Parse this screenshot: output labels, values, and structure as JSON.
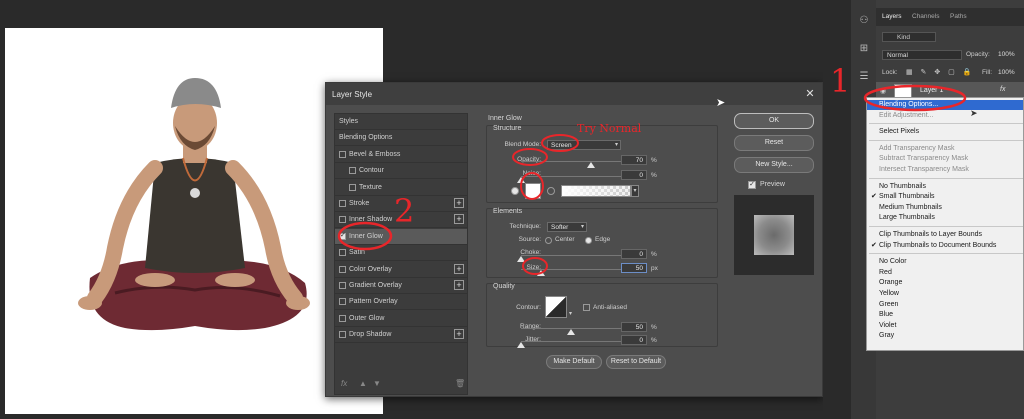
{
  "dialog": {
    "title": "Layer Style",
    "close_glyph": "✕",
    "styles_list": [
      {
        "label": "Styles",
        "checkbox": false,
        "checked": false,
        "sub": false,
        "plus": false,
        "selected": false
      },
      {
        "label": "Blending Options",
        "checkbox": false,
        "checked": false,
        "sub": false,
        "plus": false,
        "selected": false
      },
      {
        "label": "Bevel & Emboss",
        "checkbox": true,
        "checked": false,
        "sub": false,
        "plus": false,
        "selected": false
      },
      {
        "label": "Contour",
        "checkbox": true,
        "checked": false,
        "sub": true,
        "plus": false,
        "selected": false
      },
      {
        "label": "Texture",
        "checkbox": true,
        "checked": false,
        "sub": true,
        "plus": false,
        "selected": false
      },
      {
        "label": "Stroke",
        "checkbox": true,
        "checked": false,
        "sub": false,
        "plus": true,
        "selected": false
      },
      {
        "label": "Inner Shadow",
        "checkbox": true,
        "checked": false,
        "sub": false,
        "plus": true,
        "selected": false
      },
      {
        "label": "Inner Glow",
        "checkbox": true,
        "checked": true,
        "sub": false,
        "plus": false,
        "selected": true
      },
      {
        "label": "Satin",
        "checkbox": true,
        "checked": false,
        "sub": false,
        "plus": false,
        "selected": false
      },
      {
        "label": "Color Overlay",
        "checkbox": true,
        "checked": false,
        "sub": false,
        "plus": true,
        "selected": false
      },
      {
        "label": "Gradient Overlay",
        "checkbox": true,
        "checked": false,
        "sub": false,
        "plus": true,
        "selected": false
      },
      {
        "label": "Pattern Overlay",
        "checkbox": true,
        "checked": false,
        "sub": false,
        "plus": false,
        "selected": false
      },
      {
        "label": "Outer Glow",
        "checkbox": true,
        "checked": false,
        "sub": false,
        "plus": false,
        "selected": false
      },
      {
        "label": "Drop Shadow",
        "checkbox": true,
        "checked": false,
        "sub": false,
        "plus": true,
        "selected": false
      }
    ],
    "list_footer": {
      "fx": "fx",
      "up": "▲",
      "down": "▼",
      "trash": "🗑"
    },
    "section_title": "Inner Glow",
    "structure": {
      "title": "Structure",
      "blend_mode_label": "Blend Mode:",
      "blend_mode_value": "Screen",
      "opacity_label": "Opacity:",
      "opacity_value": "70",
      "opacity_fraction": 0.7,
      "noise_label": "Noise:",
      "noise_value": "0",
      "noise_fraction": 0,
      "unit": "%"
    },
    "elements": {
      "title": "Elements",
      "technique_label": "Technique:",
      "technique_value": "Softer",
      "source_label": "Source:",
      "source_center": "Center",
      "source_edge": "Edge",
      "choke_label": "Choke:",
      "choke_value": "0",
      "choke_fraction": 0,
      "size_label": "Size:",
      "size_value": "50",
      "size_fraction": 0.2,
      "size_unit": "px",
      "unit": "%"
    },
    "quality": {
      "title": "Quality",
      "contour_label": "Contour:",
      "anti_aliased_label": "Anti-aliased",
      "range_label": "Range:",
      "range_value": "50",
      "range_fraction": 0.5,
      "jitter_label": "Jitter:",
      "jitter_value": "0",
      "jitter_fraction": 0,
      "unit": "%"
    },
    "make_default": "Make Default",
    "reset_to_default": "Reset to Default",
    "ok": "OK",
    "reset": "Reset",
    "new_style": "New Style...",
    "preview_label": "Preview",
    "preview_checked": true
  },
  "annotations": {
    "number_1": "1",
    "number_2": "2",
    "try_note": "Try Normal",
    "color": "#e8262a"
  },
  "layers_panel": {
    "tabs": [
      "Layers",
      "Channels",
      "Paths"
    ],
    "kind_label": "Kind",
    "blend_mode": "Normal",
    "opacity_label": "Opacity:",
    "opacity_value": "100%",
    "lock_label": "Lock:",
    "fill_label": "Fill:",
    "fill_value": "100%",
    "layer_name": "Layer 1",
    "fx_label": "fx"
  },
  "context_menu": {
    "groups": [
      [
        {
          "label": "Blending Options...",
          "state": "highlight",
          "check": false
        },
        {
          "label": "Edit Adjustment...",
          "state": "disabled",
          "check": false
        }
      ],
      [
        {
          "label": "Select Pixels",
          "state": "normal",
          "check": false
        }
      ],
      [
        {
          "label": "Add Transparency Mask",
          "state": "disabled",
          "check": false
        },
        {
          "label": "Subtract Transparency Mask",
          "state": "disabled",
          "check": false
        },
        {
          "label": "Intersect Transparency Mask",
          "state": "disabled",
          "check": false
        }
      ],
      [
        {
          "label": "No Thumbnails",
          "state": "normal",
          "check": false
        },
        {
          "label": "Small Thumbnails",
          "state": "normal",
          "check": true
        },
        {
          "label": "Medium Thumbnails",
          "state": "normal",
          "check": false
        },
        {
          "label": "Large Thumbnails",
          "state": "normal",
          "check": false
        }
      ],
      [
        {
          "label": "Clip Thumbnails to Layer Bounds",
          "state": "normal",
          "check": false
        },
        {
          "label": "Clip Thumbnails to Document Bounds",
          "state": "normal",
          "check": true
        }
      ],
      [
        {
          "label": "No Color",
          "state": "normal",
          "check": false
        },
        {
          "label": "Red",
          "state": "normal",
          "check": false
        },
        {
          "label": "Orange",
          "state": "normal",
          "check": false
        },
        {
          "label": "Yellow",
          "state": "normal",
          "check": false
        },
        {
          "label": "Green",
          "state": "normal",
          "check": false
        },
        {
          "label": "Blue",
          "state": "normal",
          "check": false
        },
        {
          "label": "Violet",
          "state": "normal",
          "check": false
        },
        {
          "label": "Gray",
          "state": "normal",
          "check": false
        }
      ]
    ]
  },
  "colors": {
    "app_bg": "#2a2a2a",
    "dialog_bg": "#4d4d4d",
    "highlight": "#2f6ad0",
    "annotation_red": "#e8262a"
  }
}
